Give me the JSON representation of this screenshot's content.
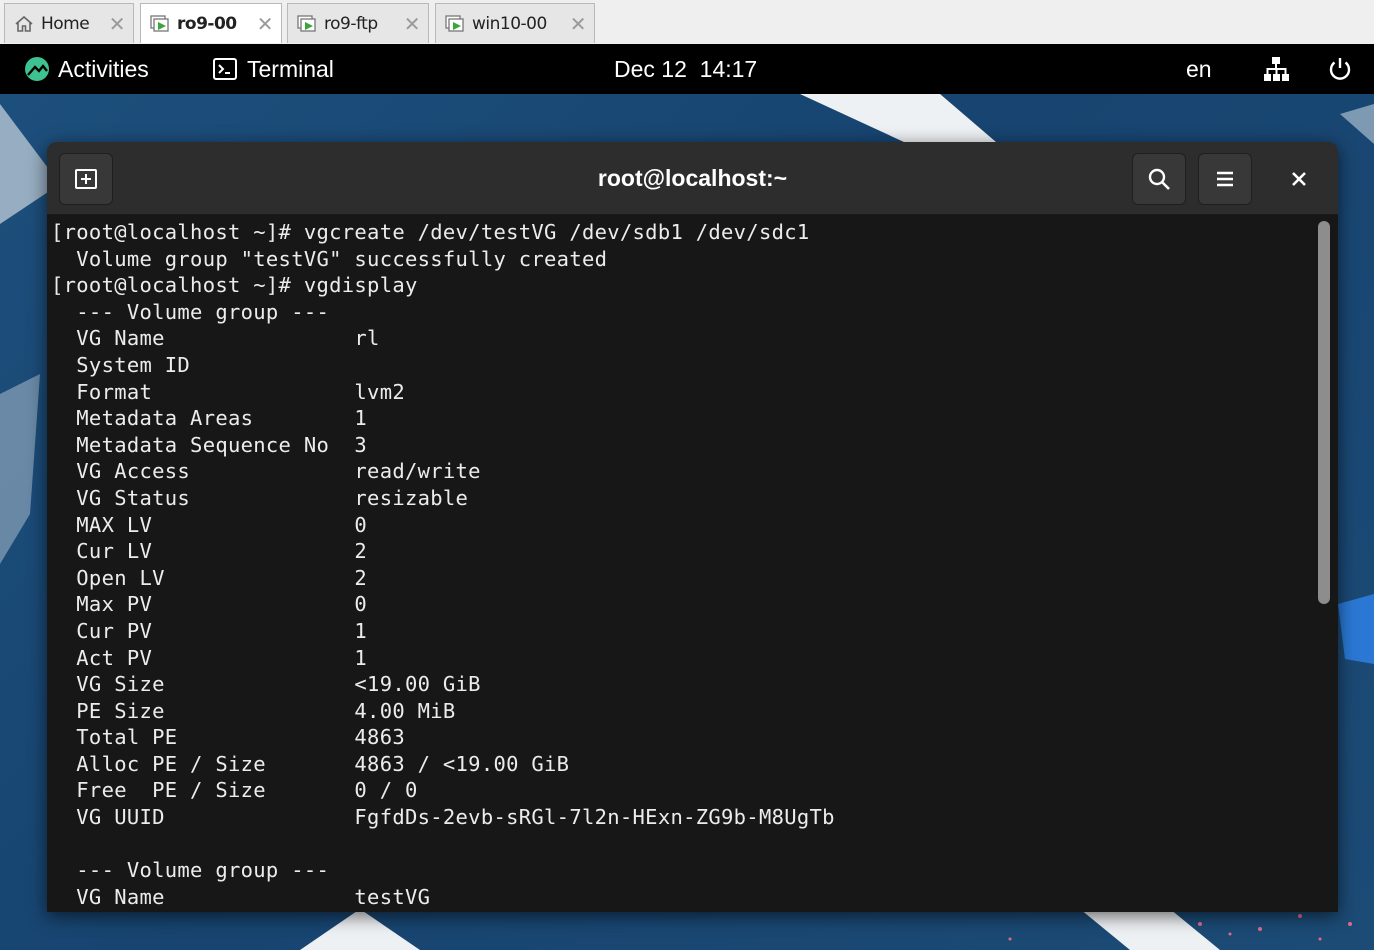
{
  "vm_tabs": [
    {
      "label": "Home",
      "icon": "home-icon",
      "active": false
    },
    {
      "label": "ro9-00",
      "icon": "vm-icon",
      "active": true
    },
    {
      "label": "ro9-ftp",
      "icon": "vm-icon",
      "active": false
    },
    {
      "label": "win10-00",
      "icon": "vm-icon",
      "active": false
    }
  ],
  "topbar": {
    "activities_label": "Activities",
    "app_label": "Terminal",
    "clock": "Dec 12  14:17",
    "language": "en"
  },
  "terminal": {
    "title": "root@localhost:~",
    "lines": [
      "[root@localhost ~]# vgcreate /dev/testVG /dev/sdb1 /dev/sdc1",
      "  Volume group \"testVG\" successfully created",
      "[root@localhost ~]# vgdisplay",
      "  --- Volume group ---",
      "  VG Name               rl",
      "  System ID",
      "  Format                lvm2",
      "  Metadata Areas        1",
      "  Metadata Sequence No  3",
      "  VG Access             read/write",
      "  VG Status             resizable",
      "  MAX LV                0",
      "  Cur LV                2",
      "  Open LV               2",
      "  Max PV                0",
      "  Cur PV                1",
      "  Act PV                1",
      "  VG Size               <19.00 GiB",
      "  PE Size               4.00 MiB",
      "  Total PE              4863",
      "  Alloc PE / Size       4863 / <19.00 GiB",
      "  Free  PE / Size       0 / 0",
      "  VG UUID               FgfdDs-2evb-sRGl-7l2n-HExn-ZG9b-M8UgTb",
      "",
      "  --- Volume group ---",
      "  VG Name               testVG"
    ]
  },
  "colors": {
    "terminal_bg": "#171717",
    "headerbar_bg": "#2d2d2d",
    "desktop_bg": "#1e4d78",
    "accent_green": "#3ec28f"
  }
}
